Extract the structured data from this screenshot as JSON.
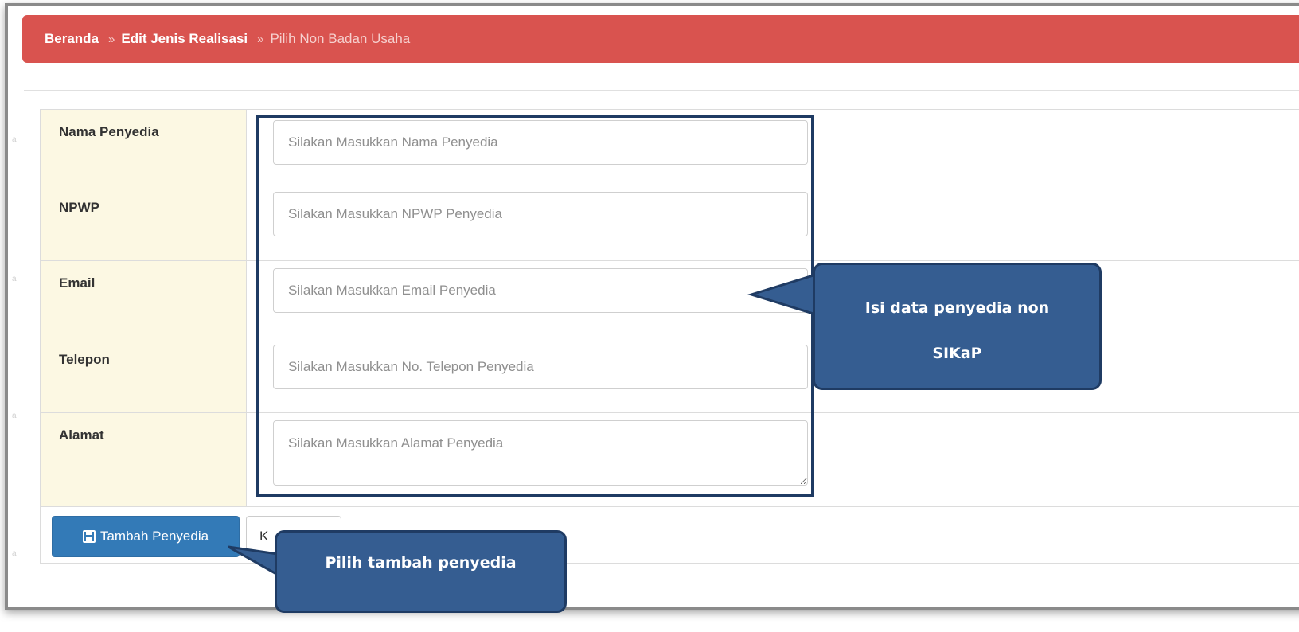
{
  "breadcrumb": {
    "home": "Beranda",
    "separator1": "»",
    "edit": "Edit Jenis Realisasi",
    "separator2": "»",
    "current": "Pilih Non Badan Usaha"
  },
  "form": {
    "fields": [
      {
        "label": "Nama Penyedia",
        "placeholder": "Silakan Masukkan Nama Penyedia"
      },
      {
        "label": "NPWP",
        "placeholder": "Silakan Masukkan NPWP Penyedia"
      },
      {
        "label": "Email",
        "placeholder": "Silakan Masukkan Email Penyedia"
      },
      {
        "label": "Telepon",
        "placeholder": "Silakan Masukkan No. Telepon Penyedia"
      },
      {
        "label": "Alamat",
        "placeholder": "Silakan Masukkan Alamat Penyedia"
      }
    ]
  },
  "actions": {
    "add_label": "Tambah Penyedia",
    "add_icon": "save-icon",
    "cancel_label": "K"
  },
  "callouts": {
    "fill_data_line1": "Isi data penyedia non",
    "fill_data_line2": "SIKaP",
    "choose_add": "Pilih tambah penyedia"
  },
  "colors": {
    "breadcrumb_bg": "#d9534f",
    "label_bg": "#fcf8e3",
    "primary_button": "#337ab7",
    "callout_bg": "#355d91",
    "callout_border": "#1f3b63"
  }
}
